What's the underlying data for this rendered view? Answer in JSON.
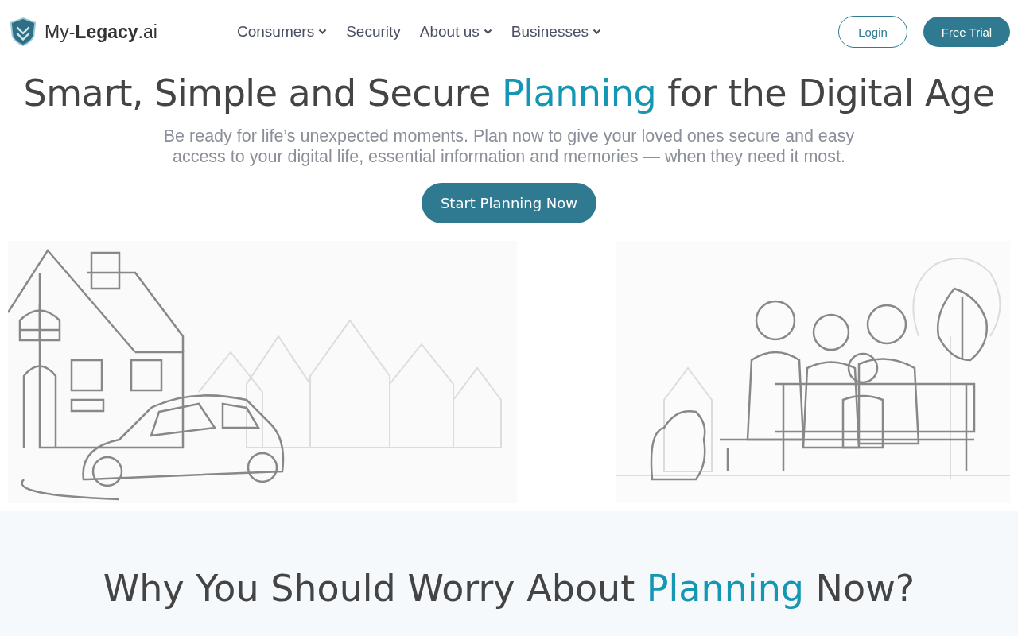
{
  "logo": {
    "text": "My-**Legacy**.ai"
  },
  "nav": [
    {
      "label": "Consumers",
      "dropdown": true
    },
    {
      "label": "Security",
      "dropdown": false
    },
    {
      "label": "About us",
      "dropdown": true
    },
    {
      "label": "Businesses",
      "dropdown": true
    }
  ],
  "actions": {
    "login": "Login",
    "trial": "Free Trial"
  },
  "hero": {
    "title_before": "Smart, Simple and Secure ",
    "title_highlight": "Planning",
    "title_after": " for the Digital Age",
    "subtitle": "Be ready for life’s unexpected moments. Plan now to give your loved ones secure and easy access to your digital life, essential information and memories — when they need it most.",
    "cta": "Start Planning Now"
  },
  "section": {
    "title_before": "Why You Should Worry About ",
    "title_highlight": "Planning",
    "title_after": " Now?"
  }
}
